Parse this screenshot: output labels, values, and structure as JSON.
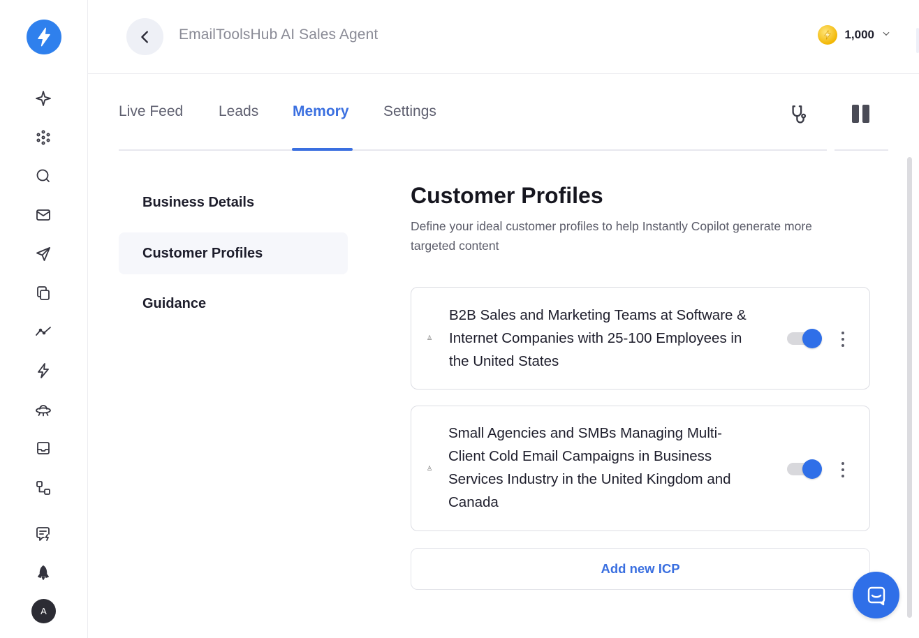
{
  "header": {
    "title": "EmailToolsHub AI Sales Agent",
    "credits": "1,000"
  },
  "tabs": [
    {
      "label": "Live Feed"
    },
    {
      "label": "Leads"
    },
    {
      "label": "Memory",
      "active": true
    },
    {
      "label": "Settings"
    }
  ],
  "subnav": [
    {
      "label": "Business Details"
    },
    {
      "label": "Customer Profiles",
      "selected": true
    },
    {
      "label": "Guidance"
    }
  ],
  "section": {
    "title": "Customer Profiles",
    "description": "Define your ideal customer profiles to help Instantly Copilot generate more targeted content"
  },
  "profiles": [
    {
      "text": "B2B Sales and Marketing Teams at Software & Internet Companies with 25-100 Employees in the United States",
      "enabled": true
    },
    {
      "text": "Small Agencies and SMBs Managing Multi-Client Cold Email Campaigns in Business Services Industry in the United Kingdom and Canada",
      "enabled": true
    }
  ],
  "add_button": "Add new ICP",
  "avatar_initial": "A",
  "colors": {
    "accent": "#3a6fe0",
    "logo": "#2f80ed",
    "toggle_on": "#2f6fe8"
  },
  "icons": {
    "sidebar": [
      "sparkle-icon",
      "network-icon",
      "search-icon",
      "mail-icon",
      "send-icon",
      "copy-icon",
      "analytics-icon",
      "bolt-icon",
      "ufo-icon",
      "inbox-icon",
      "workflow-icon",
      "chat-bolt-icon",
      "rocket-icon"
    ]
  }
}
